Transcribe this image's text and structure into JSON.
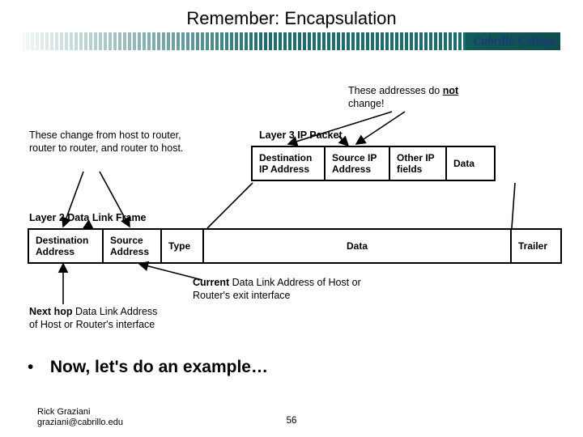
{
  "title": "Remember: Encapsulation",
  "college": "Cabrillo College",
  "notes": {
    "no_change_line1": "These addresses do ",
    "no_change_bold": "not",
    "no_change_line2": " change!",
    "change": "These change from host to router, router to router, and router to host.",
    "l3_label": "Layer 3 IP Packet",
    "l2_label": "Layer 2 Data Link Frame",
    "current": "Current",
    "current_rest": " Data Link Address of Host or Router's exit interface",
    "next_hop": "Next hop",
    "next_hop_rest": " Data Link Address of Host or Router's interface"
  },
  "l3": {
    "dest_ip": "Destination IP Address",
    "src_ip": "Source IP Address",
    "other": "Other IP fields",
    "data": "Data"
  },
  "l2": {
    "dest": "Destination Address",
    "src": "Source Address",
    "type": "Type",
    "data": "Data",
    "trailer": "Trailer"
  },
  "bullet": "Now, let's do an example…",
  "footer": {
    "name": "Rick Graziani",
    "email": "graziani@cabrillo.edu"
  },
  "page": "56"
}
